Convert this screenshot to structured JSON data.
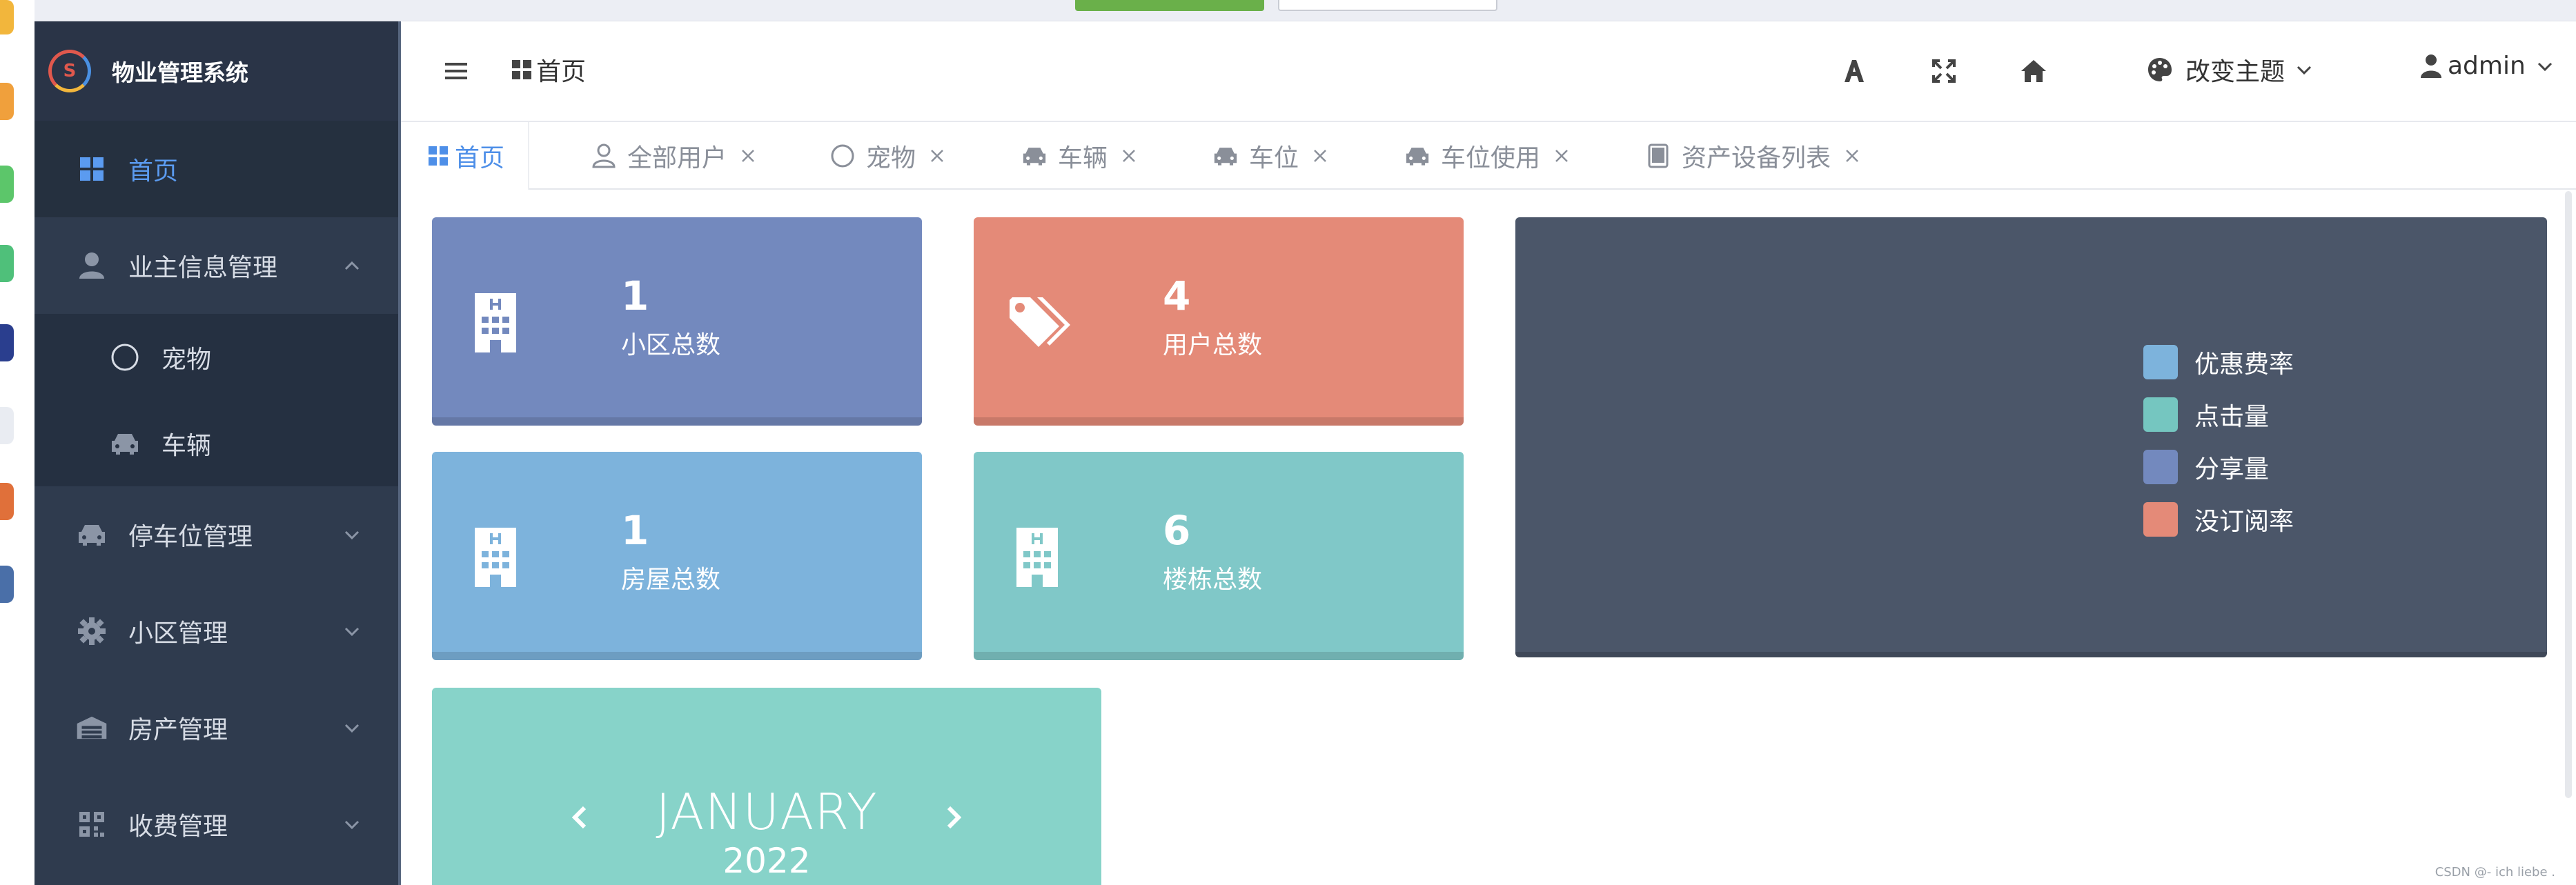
{
  "app": {
    "title": "物业管理系统"
  },
  "header": {
    "title": "首页",
    "theme_label": "改变主题",
    "user_label": "admin"
  },
  "sidebar": {
    "items": [
      {
        "label": "首页",
        "icon": "grid-icon",
        "active": true
      },
      {
        "label": "业主信息管理",
        "icon": "user-icon",
        "expanded": true,
        "children": [
          {
            "label": "宠物",
            "icon": "circle-icon"
          },
          {
            "label": "车辆",
            "icon": "car-icon"
          }
        ]
      },
      {
        "label": "停车位管理",
        "icon": "car-icon"
      },
      {
        "label": "小区管理",
        "icon": "gear-icon"
      },
      {
        "label": "房产管理",
        "icon": "warehouse-icon"
      },
      {
        "label": "收费管理",
        "icon": "qrcode-icon"
      }
    ]
  },
  "tabs": [
    {
      "label": "首页",
      "icon": "grid-icon",
      "active": true,
      "closable": false
    },
    {
      "label": "全部用户",
      "icon": "user-outline-icon",
      "closable": true
    },
    {
      "label": "宠物",
      "icon": "circle-icon",
      "closable": true
    },
    {
      "label": "车辆",
      "icon": "car-icon",
      "closable": true
    },
    {
      "label": "车位",
      "icon": "car-icon",
      "closable": true
    },
    {
      "label": "车位使用",
      "icon": "car-icon",
      "closable": true
    },
    {
      "label": "资产设备列表",
      "icon": "tablet-icon",
      "closable": true
    }
  ],
  "stats": [
    {
      "value": "1",
      "label": "小区总数",
      "icon": "building-icon",
      "color": "#7389be"
    },
    {
      "value": "4",
      "label": "用户总数",
      "icon": "tags-icon",
      "color": "#e48a78"
    },
    {
      "value": "1",
      "label": "房屋总数",
      "icon": "building-icon",
      "color": "#7db3dc"
    },
    {
      "value": "6",
      "label": "楼栋总数",
      "icon": "building-icon",
      "color": "#80c8c8"
    }
  ],
  "legend": [
    {
      "label": "优惠费率",
      "color": "#7db3dc"
    },
    {
      "label": "点击量",
      "color": "#75c6c0"
    },
    {
      "label": "分享量",
      "color": "#7389be"
    },
    {
      "label": "没订阅率",
      "color": "#e48a78"
    }
  ],
  "calendar": {
    "month": "JANUARY",
    "year": "2022"
  },
  "watermark": "CSDN @- ich liebe ."
}
